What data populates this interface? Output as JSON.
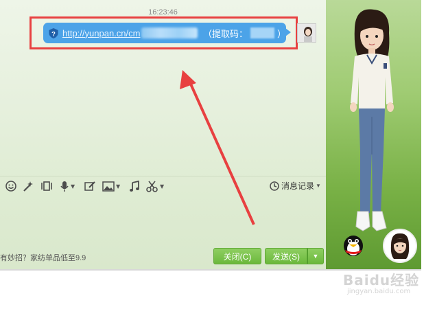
{
  "chat": {
    "timestamp": "16:23:46",
    "message": {
      "link_text": "http://yunpan.cn/cm",
      "code_label": "（提取码：",
      "code_close": "）"
    }
  },
  "toolbar": {
    "history_label": "消息记录"
  },
  "footer": {
    "ad_text": "有妙招？家纺单品低至9.9",
    "close_label": "关闭(C)",
    "send_label": "发送(S)"
  },
  "watermark": {
    "main": "Baidu经验",
    "sub": "jingyan.baidu.com"
  },
  "colors": {
    "bubble": "#4ca3e8",
    "highlight": "#e84040",
    "button_green": "#6bb83c"
  }
}
